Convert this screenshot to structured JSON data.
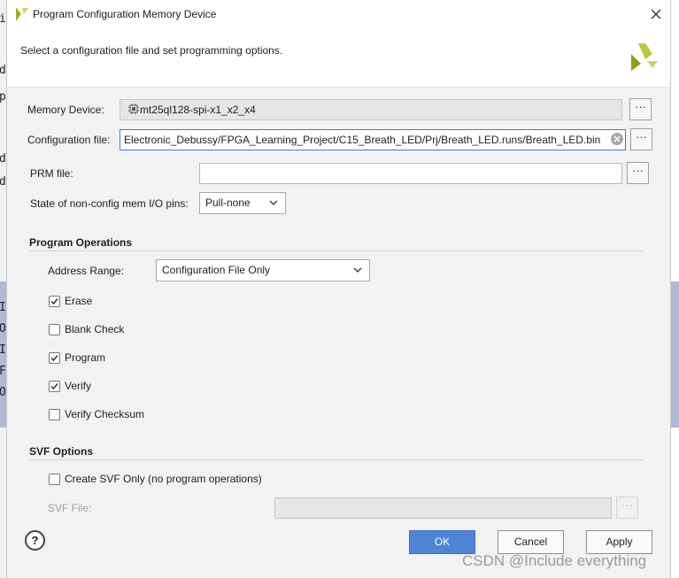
{
  "window": {
    "title": "Program Configuration Memory Device"
  },
  "header": {
    "instruction": "Select a configuration file and set programming options."
  },
  "form": {
    "memory_device_label": "Memory Device:",
    "memory_device_value": "mt25ql128-spi-x1_x2_x4",
    "config_file_label": "Configuration file:",
    "config_file_value": "Electronic_Debussy/FPGA_Learning_Project/C15_Breath_LED/Prj/Breath_LED.runs/Breath_LED.bin",
    "prm_file_label": "PRM file:",
    "prm_file_value": "",
    "state_pins_label": "State of non-config mem I/O pins:",
    "state_pins_value": "Pull-none",
    "browse_label": "···"
  },
  "program_operations": {
    "title": "Program Operations",
    "address_range_label": "Address Range:",
    "address_range_value": "Configuration File Only",
    "options": [
      {
        "label": "Erase",
        "checked": true
      },
      {
        "label": "Blank Check",
        "checked": false
      },
      {
        "label": "Program",
        "checked": true
      },
      {
        "label": "Verify",
        "checked": true
      },
      {
        "label": "Verify Checksum",
        "checked": false
      }
    ]
  },
  "svf_options": {
    "title": "SVF Options",
    "create_svf_label": "Create SVF Only (no program operations)",
    "create_svf_checked": false,
    "svf_file_label": "SVF File:",
    "svf_file_value": ""
  },
  "buttons": {
    "help": "?",
    "ok": "OK",
    "cancel": "Cancel",
    "apply": "Apply"
  },
  "background": {
    "glyphs": [
      "i",
      "d",
      "p",
      "d",
      "d",
      "I",
      "O",
      "I",
      "F",
      "O"
    ]
  },
  "watermark": "CSDN @Include everything",
  "colors": {
    "accent": "#4d84d6",
    "logo": "#9cb22a"
  }
}
